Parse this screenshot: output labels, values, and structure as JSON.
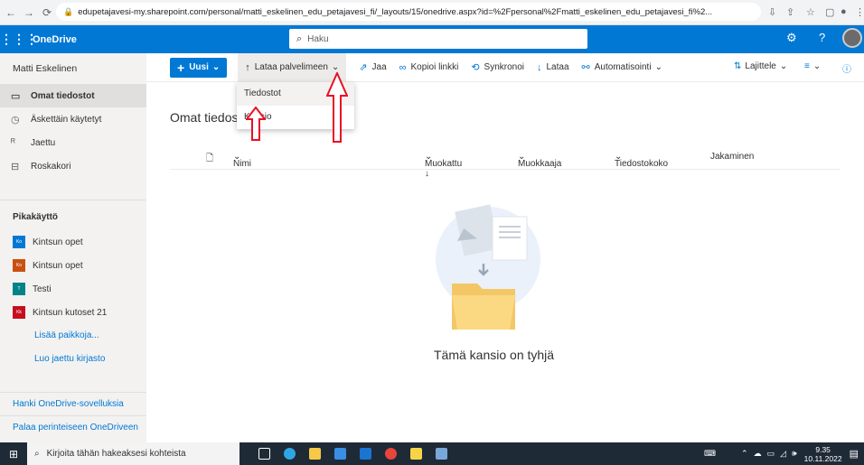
{
  "browser": {
    "url": "edupetajavesi-my.sharepoint.com/personal/matti_eskelinen_edu_petajavesi_fi/_layouts/15/onedrive.aspx?id=%2Fpersonal%2Fmatti_eskelinen_edu_petajavesi_fi%2..."
  },
  "app": {
    "name": "OneDrive",
    "search_placeholder": "Haku"
  },
  "sidebar": {
    "user": "Matti Eskelinen",
    "items": [
      {
        "label": "Omat tiedostot",
        "icon": "folder-icon",
        "active": true
      },
      {
        "label": "Äskettäin käytetyt",
        "icon": "clock-icon"
      },
      {
        "label": "Jaettu",
        "icon": "people-icon"
      },
      {
        "label": "Roskakori",
        "icon": "trash-icon"
      }
    ],
    "quick_access_title": "Pikakäyttö",
    "libraries": [
      {
        "label": "Kintsun opet",
        "color": "#0078d4",
        "abbr": "Ko"
      },
      {
        "label": "Kintsun opet",
        "color": "#ca5010",
        "abbr": "Ko"
      },
      {
        "label": "Testi",
        "color": "#038387",
        "abbr": "T"
      },
      {
        "label": "Kintsun kutoset 21",
        "color": "#c50f1f",
        "abbr": "Kk"
      }
    ],
    "more_places": "Lisää paikkoja...",
    "create_library": "Luo jaettu kirjasto",
    "get_apps": "Hanki OneDrive-sovelluksia",
    "classic": "Palaa perinteiseen OneDriveen"
  },
  "commands": {
    "new": "Uusi",
    "upload": "Lataa palvelimeen",
    "share": "Jaa",
    "copy_link": "Kopioi linkki",
    "sync": "Synkronoi",
    "download": "Lataa",
    "automate": "Automatisointi",
    "sort": "Lajittele"
  },
  "upload_menu": {
    "files": "Tiedostot",
    "folder": "Kansio"
  },
  "main": {
    "breadcrumb_visible": "Omat tiedosto",
    "columns": {
      "name": "Nimi",
      "modified": "Muokattu ↓",
      "modified_by": "Muokkaaja",
      "size": "Tiedostokoko",
      "sharing": "Jakaminen"
    },
    "empty_text": "Tämä kansio on tyhjä"
  },
  "taskbar": {
    "search_placeholder": "Kirjoita tähän hakeaksesi kohteista",
    "time": "9.35",
    "date": "10.11.2022"
  },
  "colors": {
    "brand": "#0078d4",
    "annotation": "#e81123"
  }
}
